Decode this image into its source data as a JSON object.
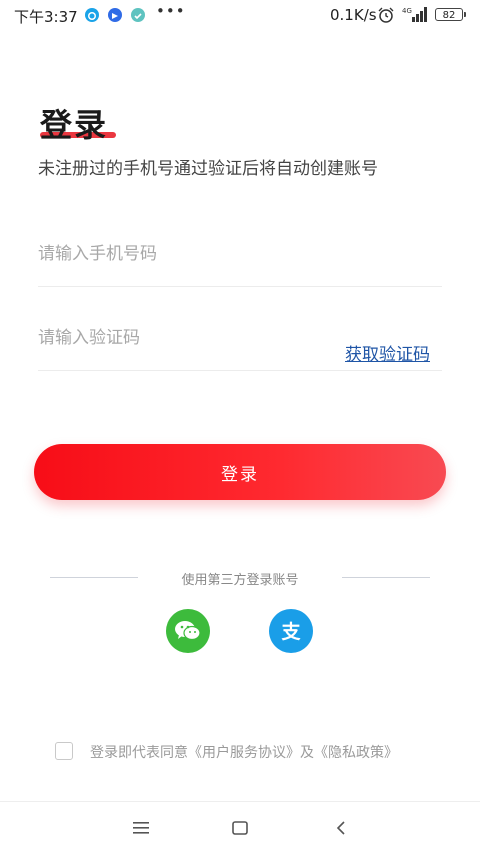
{
  "status_bar": {
    "time": "下午3:37",
    "dots": "•••",
    "network_speed": "0.1K/s",
    "signal_label": "4G",
    "battery": "82"
  },
  "page": {
    "title": "登录",
    "subtitle": "未注册过的手机号通过验证后将自动创建账号"
  },
  "form": {
    "phone_placeholder": "请输入手机号码",
    "phone_value": "",
    "code_placeholder": "请输入验证码",
    "code_value": "",
    "get_code_label": "获取验证码",
    "login_button": "登录"
  },
  "third_party": {
    "label": "使用第三方登录账号",
    "providers": [
      {
        "name": "wechat",
        "color": "#3dbb3c"
      },
      {
        "name": "alipay",
        "color": "#1a9ee8"
      }
    ]
  },
  "agreement": {
    "checked": false,
    "text": "登录即代表同意《用户服务协议》及《隐私政策》"
  },
  "colors": {
    "accent": "#f70d17",
    "link": "#1f55a6"
  }
}
